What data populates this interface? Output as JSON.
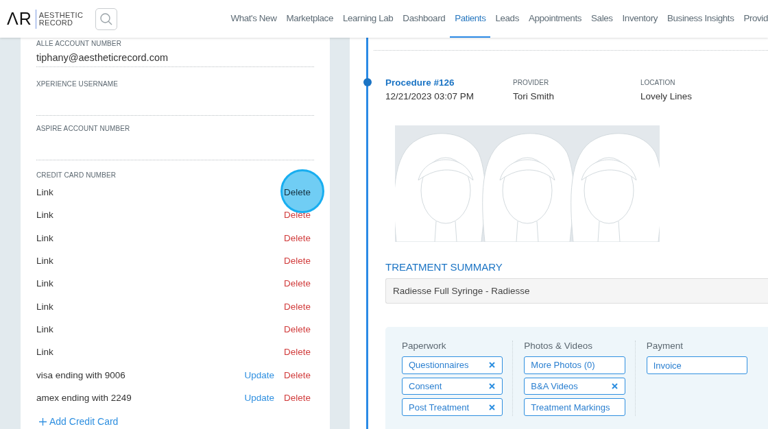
{
  "header": {
    "logo_mark": "ΛR",
    "logo_text": [
      "AESTHETIC",
      "RECORD"
    ]
  },
  "nav": [
    {
      "label": "What's New",
      "selected": false
    },
    {
      "label": "Marketplace",
      "selected": false
    },
    {
      "label": "Learning Lab",
      "selected": false
    },
    {
      "label": "Dashboard",
      "selected": false
    },
    {
      "label": "Patients",
      "selected": true
    },
    {
      "label": "Leads",
      "selected": false
    },
    {
      "label": "Appointments",
      "selected": false
    },
    {
      "label": "Sales",
      "selected": false
    },
    {
      "label": "Inventory",
      "selected": false
    },
    {
      "label": "Business Insights",
      "selected": false
    },
    {
      "label": "Provid",
      "selected": false
    }
  ],
  "account_fields": [
    {
      "label": "ALLE ACCOUNT NUMBER",
      "value": "tiphany@aestheticrecord.com"
    },
    {
      "label": "XPERIENCE USERNAME"
    },
    {
      "label": "ASPIRE ACCOUNT NUMBER"
    }
  ],
  "credit_cards": {
    "label": "CREDIT CARD NUMBER",
    "add_label": "Add Credit Card",
    "cards": [
      {
        "name": "Link",
        "highlighted": true,
        "actions": [
          {
            "kind": "delete",
            "label": "Delete"
          }
        ]
      },
      {
        "name": "Link",
        "highlighted": false,
        "actions": [
          {
            "kind": "delete",
            "label": "Delete"
          }
        ]
      },
      {
        "name": "Link",
        "highlighted": false,
        "actions": [
          {
            "kind": "delete",
            "label": "Delete"
          }
        ]
      },
      {
        "name": "Link",
        "highlighted": false,
        "actions": [
          {
            "kind": "delete",
            "label": "Delete"
          }
        ]
      },
      {
        "name": "Link",
        "highlighted": false,
        "actions": [
          {
            "kind": "delete",
            "label": "Delete"
          }
        ]
      },
      {
        "name": "Link",
        "highlighted": false,
        "actions": [
          {
            "kind": "delete",
            "label": "Delete"
          }
        ]
      },
      {
        "name": "Link",
        "highlighted": false,
        "actions": [
          {
            "kind": "delete",
            "label": "Delete"
          }
        ]
      },
      {
        "name": "Link",
        "highlighted": false,
        "actions": [
          {
            "kind": "delete",
            "label": "Delete"
          }
        ]
      },
      {
        "name": "visa ending with 9006",
        "highlighted": false,
        "actions": [
          {
            "kind": "update",
            "label": "Update"
          },
          {
            "kind": "delete",
            "label": "Delete"
          }
        ]
      },
      {
        "name": "amex ending with 2249",
        "highlighted": false,
        "actions": [
          {
            "kind": "update",
            "label": "Update"
          },
          {
            "kind": "delete",
            "label": "Delete"
          }
        ]
      }
    ]
  },
  "procedure": {
    "title": "Procedure #126",
    "date": "12/21/2023 03:07 PM",
    "provider_label": "PROVIDER",
    "provider": "Tori Smith",
    "location_label": "LOCATION",
    "location": "Lovely Lines"
  },
  "treatment_summary": {
    "title": "TREATMENT SUMMARY",
    "value": "Radiesse Full Syringe - Radiesse"
  },
  "documents": [
    {
      "title": "Paperwork",
      "items": [
        {
          "label": "Questionnaires",
          "removable": true
        },
        {
          "label": "Consent",
          "removable": true
        },
        {
          "label": "Post Treatment",
          "removable": true
        }
      ]
    },
    {
      "title": "Photos & Videos",
      "items": [
        {
          "label": "More Photos (0)",
          "removable": false
        },
        {
          "label": "B&A Videos",
          "removable": true
        },
        {
          "label": "Treatment Markings",
          "removable": false
        }
      ]
    },
    {
      "title": "Payment",
      "items": [
        {
          "label": "Invoice",
          "removable": false
        }
      ]
    }
  ]
}
